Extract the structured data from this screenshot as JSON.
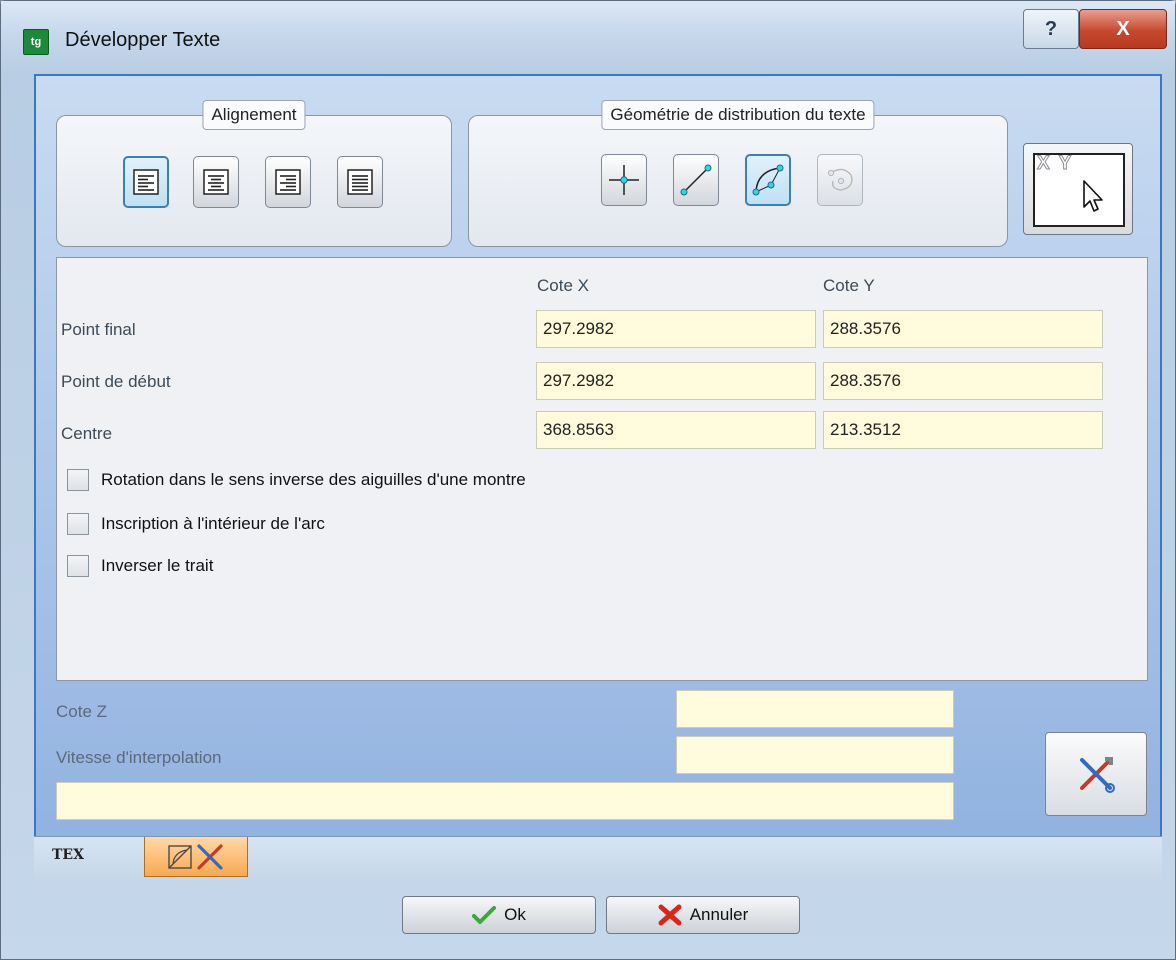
{
  "window": {
    "title": "Développer Texte",
    "app_icon_text": "tg",
    "help_label": "?",
    "close_label": "X"
  },
  "alignment": {
    "title": "Alignement",
    "buttons": [
      "align-left",
      "align-center",
      "align-right",
      "align-justify"
    ],
    "active_index": 0
  },
  "geometry": {
    "title": "Géométrie de distribution du texte",
    "buttons": [
      "point",
      "line",
      "arc",
      "circle"
    ],
    "active_index": 2,
    "disabled_index": 3
  },
  "pick": {
    "glyph_text": "X Y"
  },
  "coords": {
    "header_x": "Cote X",
    "header_y": "Cote Y",
    "rows": [
      {
        "label": "Point final",
        "x": "297.2982",
        "y": "288.3576"
      },
      {
        "label": "Point de début",
        "x": "297.2982",
        "y": "288.3576"
      },
      {
        "label": "Centre",
        "x": "368.8563",
        "y": "213.3512"
      }
    ]
  },
  "options": [
    {
      "label": "Rotation dans le sens inverse des aiguilles d'une montre",
      "checked": false
    },
    {
      "label": "Inscription à l'intérieur de l'arc",
      "checked": false
    },
    {
      "label": "Inverser le trait",
      "checked": false
    }
  ],
  "bottom": {
    "z_label": "Cote Z",
    "z_value": "",
    "speed_label": "Vitesse d'interpolation",
    "speed_value": "",
    "extra_value": ""
  },
  "tabs": {
    "text_tab": "TEX",
    "tools_tab_icon": "tools-icon"
  },
  "buttons": {
    "ok": "Ok",
    "cancel": "Annuler"
  },
  "colors": {
    "field_bg": "#fffbdc",
    "active_tab": "#f9a94e",
    "accent": "#3a77c6"
  }
}
